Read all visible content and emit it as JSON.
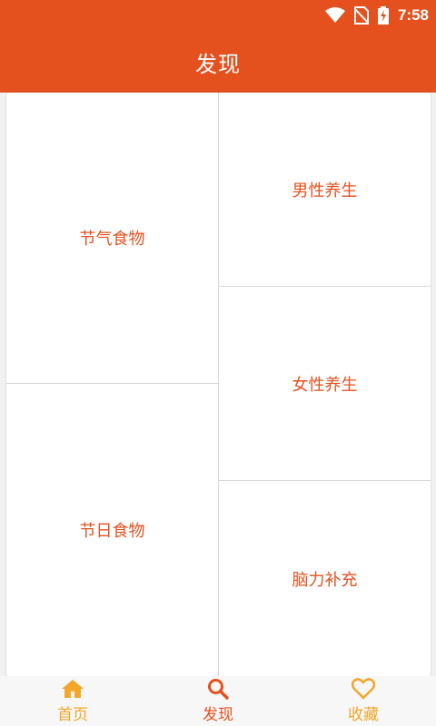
{
  "status_bar": {
    "time": "7:58",
    "icons": [
      "wifi-icon",
      "no-sim-icon",
      "battery-charging-icon"
    ]
  },
  "app_bar": {
    "title": "发现"
  },
  "tiles": [
    {
      "label": "节气食物"
    },
    {
      "label": "男性养生"
    },
    {
      "label": "女性养生"
    },
    {
      "label": "节日食物"
    },
    {
      "label": "脑力补充"
    }
  ],
  "bottom_nav": {
    "items": [
      {
        "label": "首页",
        "icon": "home-icon"
      },
      {
        "label": "发现",
        "icon": "search-icon",
        "active": true
      },
      {
        "label": "收藏",
        "icon": "heart-icon"
      }
    ]
  },
  "colors": {
    "primary": "#e4511f",
    "accent": "#f2a62a",
    "divider": "#d8d8d8"
  }
}
